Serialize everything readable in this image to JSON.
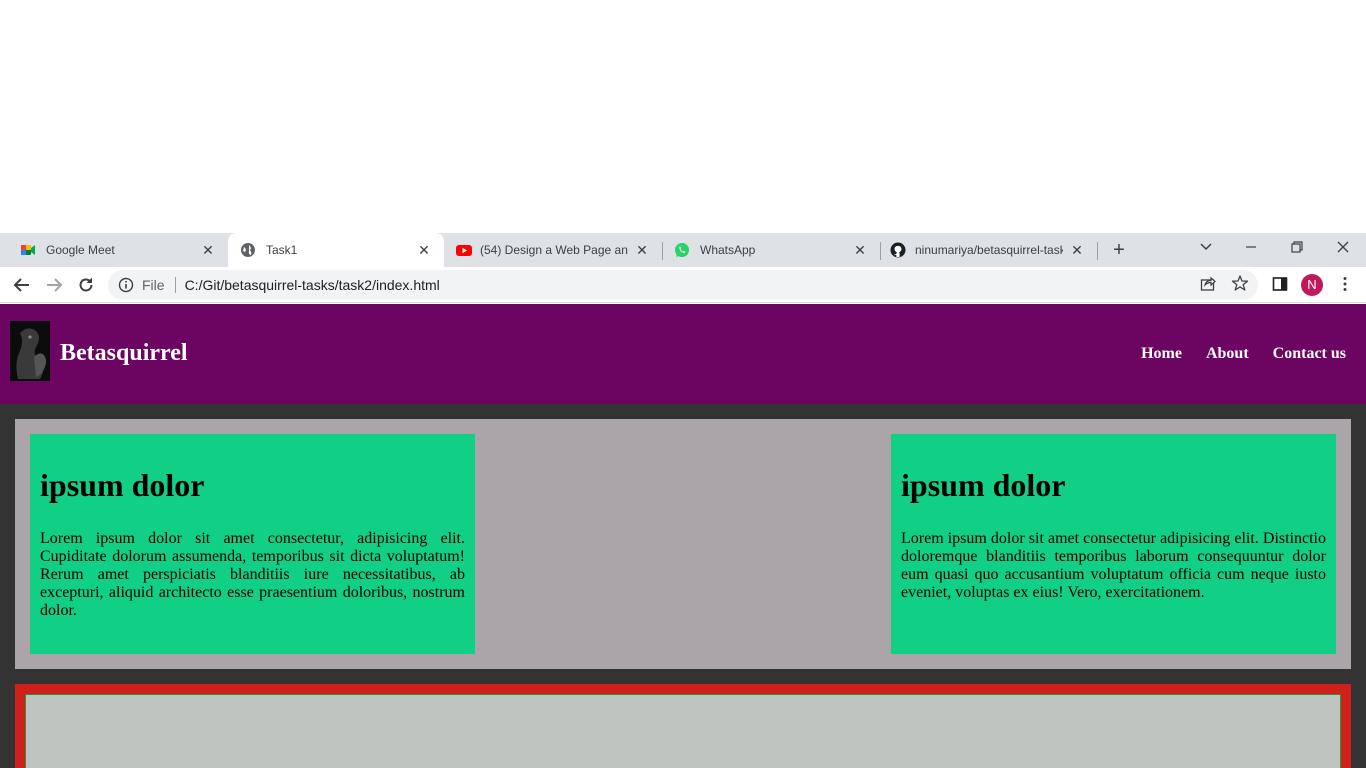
{
  "browser": {
    "tabs": [
      {
        "title": "Google Meet",
        "icon": "google-meet-icon",
        "active": false
      },
      {
        "title": "Task1",
        "icon": "globe-icon",
        "active": true
      },
      {
        "title": "(54) Design a Web Page and",
        "icon": "youtube-icon",
        "active": false
      },
      {
        "title": "WhatsApp",
        "icon": "whatsapp-icon",
        "active": false
      },
      {
        "title": "ninumariya/betasquirrel-task",
        "icon": "github-icon",
        "active": false
      }
    ],
    "omnibox": {
      "scheme_label": "File",
      "url": "C:/Git/betasquirrel-tasks/task2/index.html"
    },
    "profile_initial": "N"
  },
  "site": {
    "brand": "Betasquirrel",
    "nav": [
      "Home",
      "About",
      "Contact us"
    ],
    "colors": {
      "header": "#6c0462",
      "card": "#12cf86",
      "container": "#aba4a9",
      "page_bg": "#333333",
      "border_box": "#d0201a"
    },
    "cards": [
      {
        "heading": "ipsum dolor",
        "text": "Lorem ipsum dolor sit amet consectetur, adipisicing elit. Cupiditate dolorum assumenda, temporibus sit dicta voluptatum! Rerum amet perspiciatis blanditiis iure necessitatibus, ab excepturi, aliquid architecto esse praesentium doloribus, nostrum dolor."
      },
      {
        "heading": "ipsum dolor",
        "text": "Lorem ipsum dolor sit amet consectetur adipisicing elit. Distinctio doloremque blanditiis temporibus laborum consequuntur dolor eum quasi quo accusantium voluptatum officia cum neque iusto eveniet, voluptas ex eius! Vero, exercitationem."
      }
    ]
  }
}
